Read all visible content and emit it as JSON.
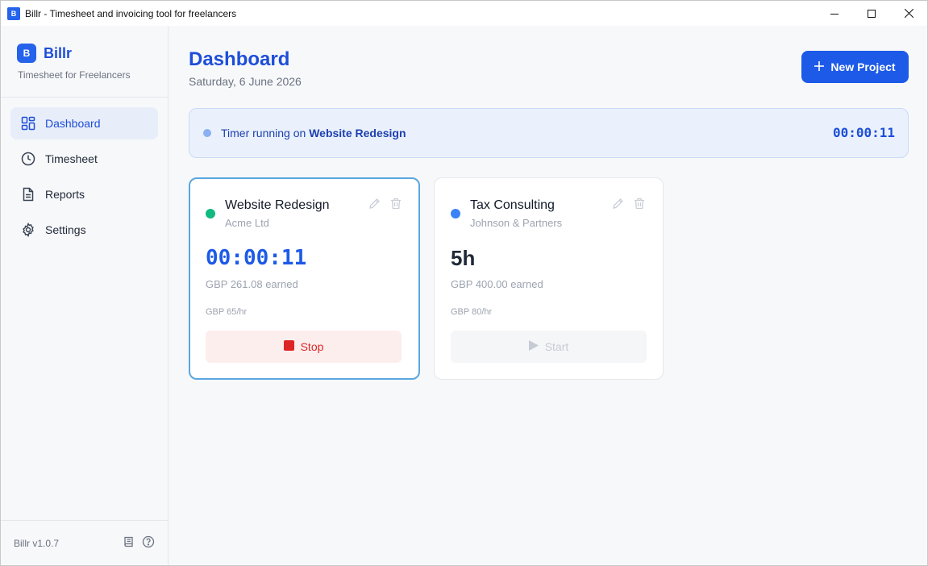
{
  "window": {
    "title": "Billr - Timesheet and invoicing tool for freelancers",
    "icon_letter": "B"
  },
  "sidebar": {
    "brand_letter": "B",
    "brand_name": "Billr",
    "brand_subtitle": "Timesheet for Freelancers",
    "items": [
      {
        "label": "Dashboard",
        "icon": "dashboard-grid-icon",
        "active": true
      },
      {
        "label": "Timesheet",
        "icon": "clock-icon",
        "active": false
      },
      {
        "label": "Reports",
        "icon": "document-icon",
        "active": false
      },
      {
        "label": "Settings",
        "icon": "gear-icon",
        "active": false
      }
    ],
    "version": "Billr v1.0.7"
  },
  "header": {
    "title": "Dashboard",
    "date": "Saturday, 6 June 2026",
    "new_project_label": "New Project"
  },
  "timer_banner": {
    "prefix": "Timer running on ",
    "project": "Website Redesign",
    "elapsed": "00:00:11"
  },
  "projects": [
    {
      "name": "Website Redesign",
      "client": "Acme Ltd",
      "value": "00:00:11",
      "earned": "GBP 261.08 earned",
      "rate": "GBP 65/hr",
      "button_label": "Stop",
      "dot_color": "#10b981",
      "running": true
    },
    {
      "name": "Tax Consulting",
      "client": "Johnson & Partners",
      "value": "5h",
      "earned": "GBP 400.00 earned",
      "rate": "GBP 80/hr",
      "button_label": "Start",
      "dot_color": "#3b82f6",
      "running": false
    }
  ],
  "colors": {
    "accent": "#1d5ae8",
    "stop": "#dc2626"
  }
}
